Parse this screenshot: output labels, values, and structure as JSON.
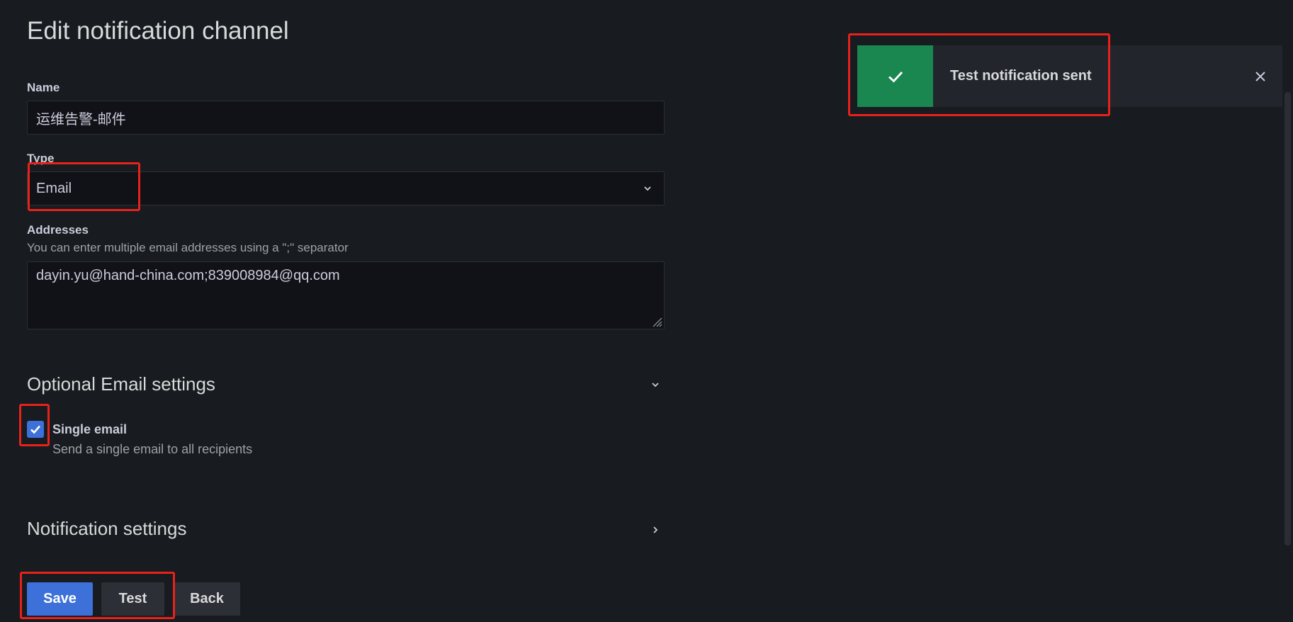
{
  "page": {
    "title": "Edit notification channel"
  },
  "form": {
    "name": {
      "label": "Name",
      "value": "运维告警-邮件"
    },
    "type": {
      "label": "Type",
      "value": "Email"
    },
    "addresses": {
      "label": "Addresses",
      "description": "You can enter multiple email addresses using a \";\" separator",
      "value": "dayin.yu@hand-china.com;839008984@qq.com"
    }
  },
  "optional_email_settings": {
    "heading": "Optional Email settings",
    "expanded": true,
    "single_email": {
      "label": "Single email",
      "description": "Send a single email to all recipients",
      "checked": true
    }
  },
  "notification_settings": {
    "heading": "Notification settings",
    "expanded": false
  },
  "actions": {
    "save_label": "Save",
    "test_label": "Test",
    "back_label": "Back"
  },
  "toast": {
    "message": "Test notification sent",
    "status": "success"
  },
  "colors": {
    "primary": "#3d71d9",
    "success": "#1a8751",
    "annotation": "#e8221b",
    "background": "#181b1f"
  },
  "icons": {
    "select": "chevron-down-icon",
    "expanded_section": "chevron-down-icon",
    "collapsed_section": "chevron-right-icon",
    "toast_status": "checkmark-icon",
    "toast_dismiss": "close-icon",
    "checkbox": "checkmark-icon"
  }
}
